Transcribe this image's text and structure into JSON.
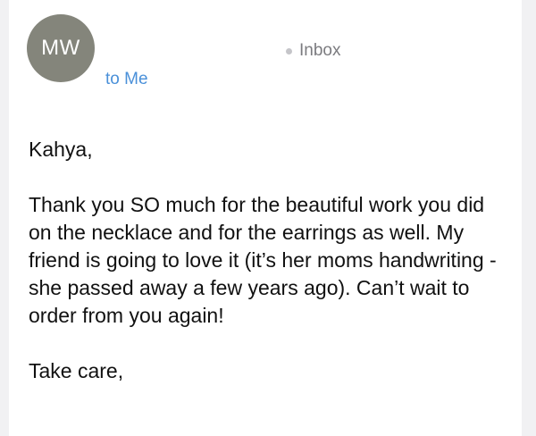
{
  "header": {
    "avatar_initials": "MW",
    "mailbox": "Inbox",
    "recipient": "to Me"
  },
  "message": {
    "greeting": "Kahya,",
    "body": "Thank you SO much for the beautiful work you did on the necklace and for the earrings as well. My friend is going to love it (it’s her moms handwriting - she passed away a few years ago). Can’t wait to order from you again!",
    "signoff": "Take care,"
  },
  "colors": {
    "avatar_bg": "#84857b",
    "link_blue": "#4a90d9",
    "meta_gray": "#7b7b7f"
  }
}
